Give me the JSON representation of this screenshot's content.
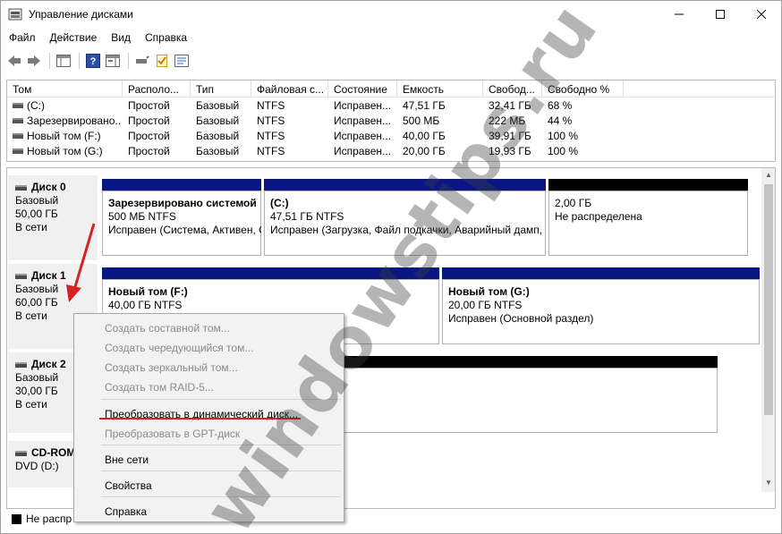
{
  "window": {
    "title": "Управление дисками"
  },
  "menu": [
    "Файл",
    "Действие",
    "Вид",
    "Справка"
  ],
  "volumes": {
    "columns": [
      "Том",
      "Располо...",
      "Тип",
      "Файловая с...",
      "Состояние",
      "Емкость",
      "Свобод...",
      "Свободно %"
    ],
    "rows": [
      [
        "(C:)",
        "Простой",
        "Базовый",
        "NTFS",
        "Исправен...",
        "47,51 ГБ",
        "32,41 ГБ",
        "68 %"
      ],
      [
        "Зарезервировано...",
        "Простой",
        "Базовый",
        "NTFS",
        "Исправен...",
        "500 МБ",
        "222 МБ",
        "44 %"
      ],
      [
        "Новый том (F:)",
        "Простой",
        "Базовый",
        "NTFS",
        "Исправен...",
        "40,00 ГБ",
        "39,91 ГБ",
        "100 %"
      ],
      [
        "Новый том (G:)",
        "Простой",
        "Базовый",
        "NTFS",
        "Исправен...",
        "20,00 ГБ",
        "19,93 ГБ",
        "100 %"
      ]
    ]
  },
  "disks": [
    {
      "name": "Диск 0",
      "type": "Базовый",
      "size": "50,00 ГБ",
      "status": "В сети",
      "partitions": [
        {
          "name": "Зарезервировано системой",
          "size": "500 МБ NTFS",
          "status": "Исправен (Система, Активен, Основной раздел)"
        },
        {
          "name": "(C:)",
          "size": "47,51 ГБ NTFS",
          "status": "Исправен (Загрузка, Файл подкачки, Аварийный дамп, Основной раздел)"
        },
        {
          "name": "",
          "size": "2,00 ГБ",
          "status": "Не распределена"
        }
      ]
    },
    {
      "name": "Диск 1",
      "type": "Базовый",
      "size": "60,00 ГБ",
      "status": "В сети",
      "partitions": [
        {
          "name": "Новый том  (F:)",
          "size": "40,00 ГБ NTFS",
          "status": ""
        },
        {
          "name": "Новый том  (G:)",
          "size": "20,00 ГБ NTFS",
          "status": "Исправен (Основной раздел)"
        }
      ]
    },
    {
      "name": "Диск 2",
      "type": "Базовый",
      "size": "30,00 ГБ",
      "status": "В сети"
    },
    {
      "name": "CD-ROM",
      "type": "DVD (D:)"
    }
  ],
  "legend": {
    "unallocated": "Не распр"
  },
  "context_menu": {
    "items": [
      "Создать составной том...",
      "Создать чередующийся том...",
      "Создать зеркальный том...",
      "Создать том RAID-5...",
      "Преобразовать в динамический диск...",
      "Преобразовать в GPT-диск",
      "Вне сети",
      "Свойства",
      "Справка"
    ]
  },
  "watermark": "windowstips.ru",
  "colors": {
    "primary_partition_bar": "#0a1682",
    "unallocated_bar": "#000000",
    "highlight_underline": "#d92020"
  }
}
